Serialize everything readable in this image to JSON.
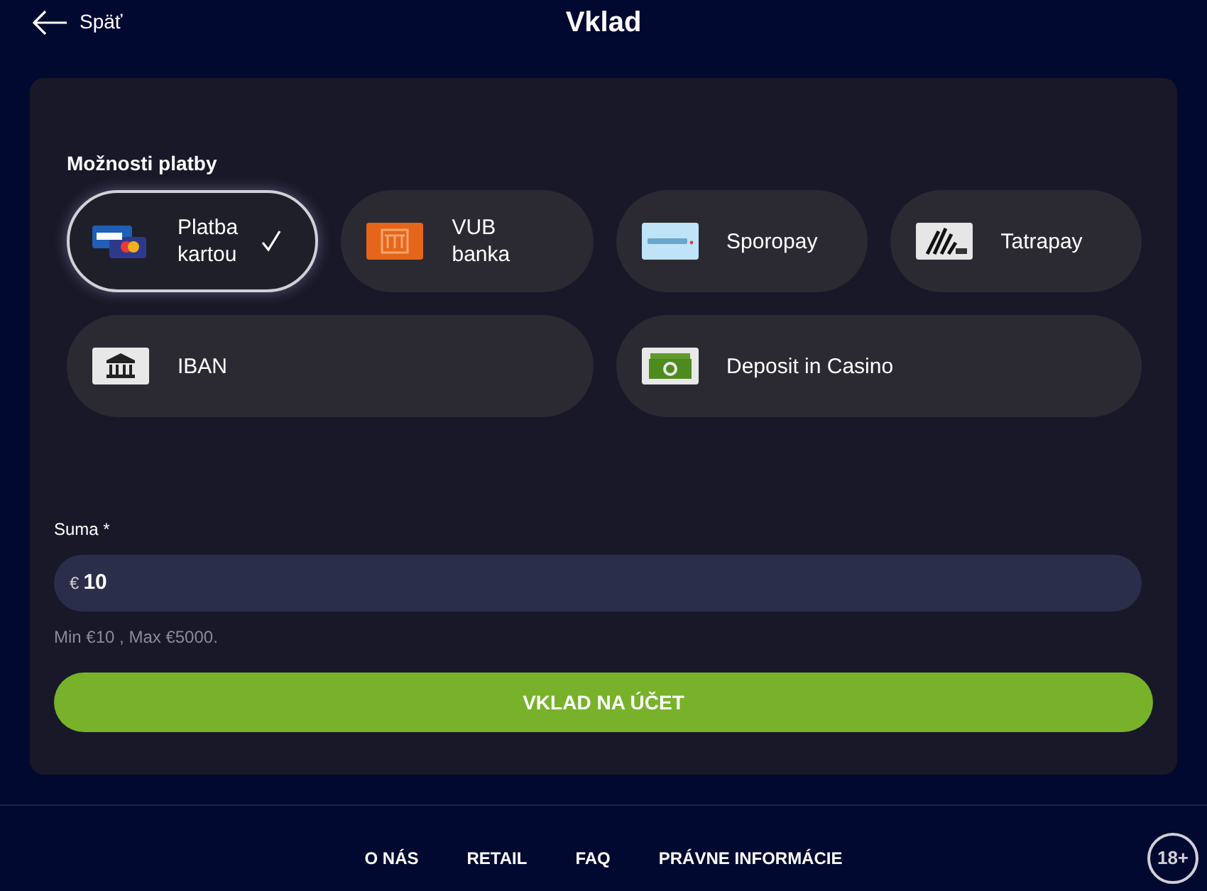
{
  "header": {
    "back": "Späť",
    "title": "Vklad"
  },
  "payment_options": {
    "label": "Možnosti platby",
    "methods": [
      {
        "kind": "card",
        "label": "Platba kartou",
        "selected": true
      },
      {
        "kind": "bank",
        "label": "VUB banka",
        "selected": false
      },
      {
        "kind": "sporopay",
        "label": "Sporopay",
        "selected": false
      },
      {
        "kind": "tatrapay",
        "label": "Tatrapay",
        "selected": false
      },
      {
        "kind": "iban",
        "label": "IBAN",
        "selected": false
      },
      {
        "kind": "cash",
        "label": "Deposit in Casino",
        "selected": false
      }
    ]
  },
  "amount": {
    "label": "Suma *",
    "currency": "€",
    "value": "10",
    "hint": "Min €10 , Max €5000."
  },
  "submit": "VKLAD NA ÚČET",
  "footer": {
    "links": [
      "O NÁS",
      "RETAIL",
      "FAQ",
      "PRÁVNE INFORMÁCIE"
    ],
    "age_badge": "18+"
  }
}
